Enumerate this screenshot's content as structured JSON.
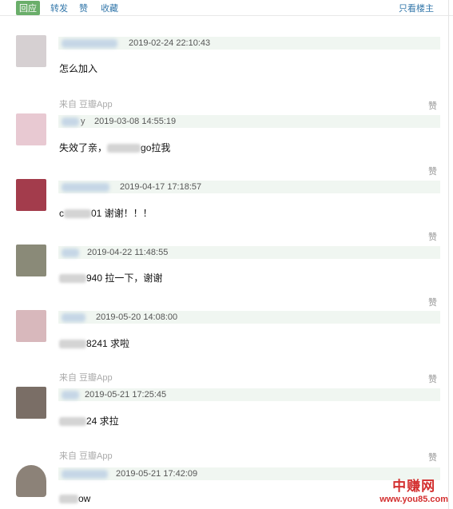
{
  "topbar": {
    "reply_tab": "回应",
    "repost_tab": "转发",
    "like_tab": "赞",
    "collect_tab": "收藏",
    "only_op": "只看楼主"
  },
  "comments": [
    {
      "timestamp": "2019-02-24 22:10:43",
      "source": "",
      "like": "",
      "content_suffix": "怎么加入",
      "avatar_color": "#d6d0d2"
    },
    {
      "timestamp": "2019-03-08 14:55:19",
      "source": "来自 豆瓣App",
      "like": "赞",
      "content_prefix": "失效了亲，",
      "content_suffix": "go拉我",
      "name_suffix": "y",
      "avatar_color": "#e8c9d2"
    },
    {
      "timestamp": "2019-04-17 17:18:57",
      "source": "",
      "like": "赞",
      "content_prefix": "c",
      "content_suffix": "01 谢谢！！！",
      "avatar_color": "#a33c4c"
    },
    {
      "timestamp": "2019-04-22 11:48:55",
      "source": "",
      "like": "赞",
      "content_suffix": "940 拉一下，谢谢",
      "avatar_color": "#8a8a78"
    },
    {
      "timestamp": "2019-05-20 14:08:00",
      "source": "",
      "like": "赞",
      "content_suffix": "8241 求啦",
      "avatar_color": "#d8b8bc"
    },
    {
      "timestamp": "2019-05-21 17:25:45",
      "source": "来自 豆瓣App",
      "like": "赞",
      "content_suffix": "24 求拉",
      "avatar_color": "#7a6e66"
    },
    {
      "timestamp": "2019-05-21 17:42:09",
      "source": "来自 豆瓣App",
      "like": "赞",
      "content_suffix": "ow",
      "avatar_color": "#8c8278"
    }
  ],
  "watermark": {
    "title": "中赚网",
    "url": "www.you85.com"
  },
  "colors": {
    "accent_green": "#6aae6a",
    "link_blue": "#3377aa",
    "meta_bg": "#f0f6f1",
    "watermark_red": "#d32f2f"
  }
}
